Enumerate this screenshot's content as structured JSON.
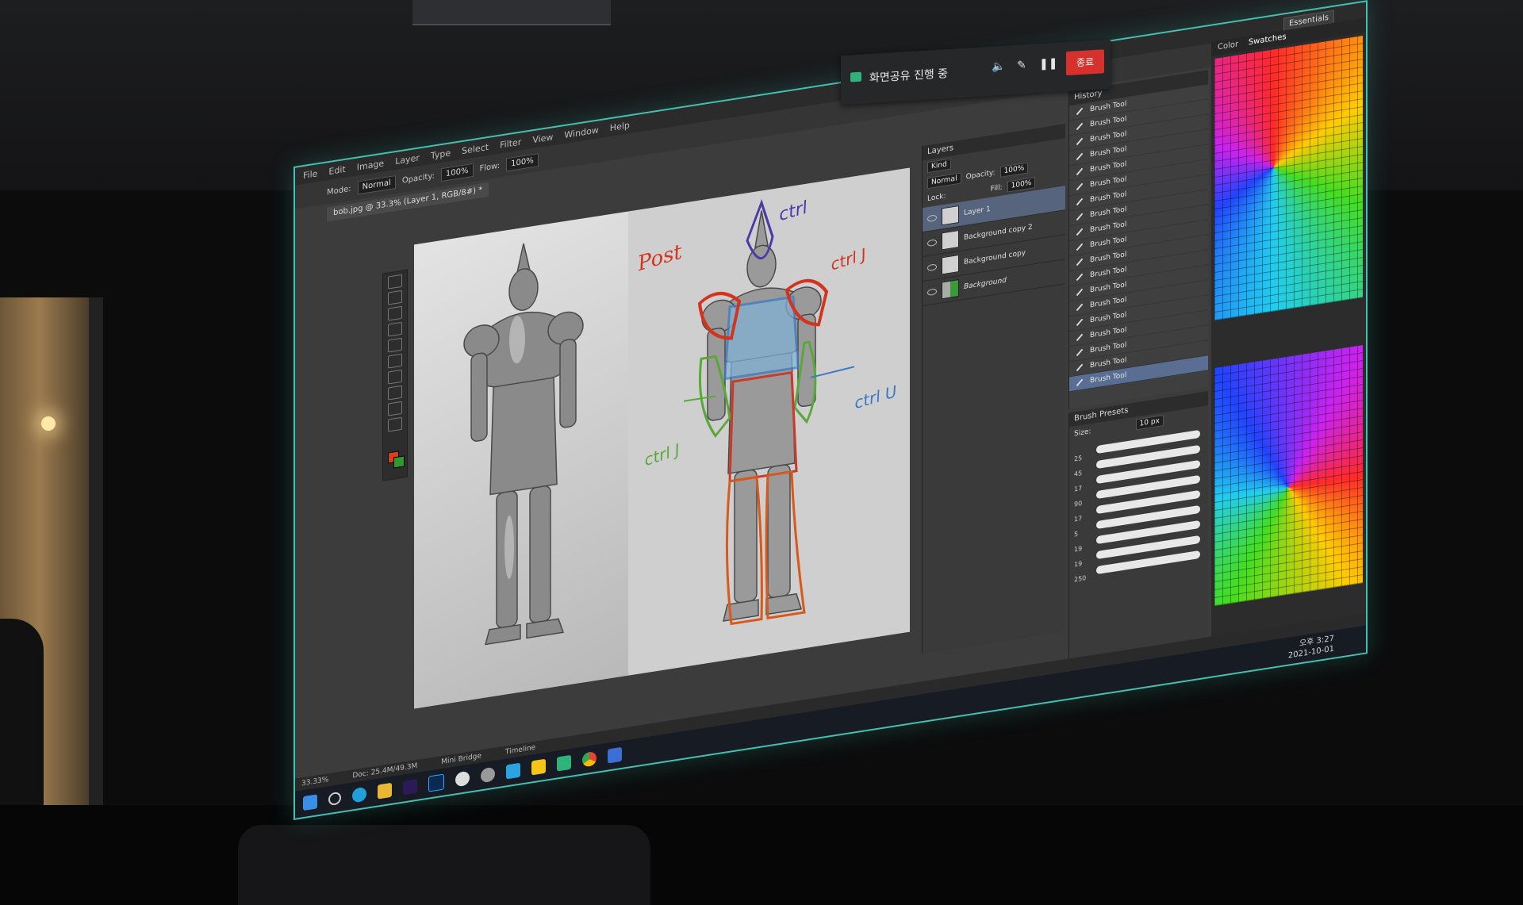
{
  "screen_share": {
    "label": "화면공유 진행 중",
    "end_label": "종료"
  },
  "photoshop": {
    "menu": [
      "File",
      "Edit",
      "Image",
      "Layer",
      "Type",
      "Select",
      "Filter",
      "View",
      "Window",
      "Help"
    ],
    "options": {
      "mode_label": "Mode:",
      "mode_value": "Normal",
      "opacity_label": "Opacity:",
      "opacity_value": "100%",
      "flow_label": "Flow:",
      "flow_value": "100%"
    },
    "doc_tab": "bob.jpg @ 33.3% (Layer 1, RGB/8#) *",
    "workspace": "Essentials",
    "layers_panel": {
      "title": "Layers",
      "kind": "Kind",
      "blend": "Normal",
      "opacity_label": "Opacity:",
      "opacity_value": "100%",
      "lock_label": "Lock:",
      "fill_label": "Fill:",
      "fill_value": "100%",
      "layers": [
        "Layer 1",
        "Background copy 2",
        "Background copy",
        "Background"
      ]
    },
    "history_panel": {
      "title": "History",
      "items": [
        "Brush Tool",
        "Brush Tool",
        "Brush Tool",
        "Brush Tool",
        "Brush Tool",
        "Brush Tool",
        "Brush Tool",
        "Brush Tool",
        "Brush Tool",
        "Brush Tool",
        "Brush Tool",
        "Brush Tool",
        "Brush Tool",
        "Brush Tool",
        "Brush Tool",
        "Brush Tool",
        "Brush Tool",
        "Brush Tool",
        "Brush Tool"
      ]
    },
    "brush_presets": {
      "title": "Brush Presets",
      "size_label": "Size:",
      "size_value": "10 px",
      "sizes": [
        "25",
        "45",
        "17",
        "90",
        "17",
        "5",
        "19",
        "19",
        "250"
      ]
    },
    "color_panel": {
      "tabs": [
        "Color",
        "Swatches"
      ]
    },
    "annotations": [
      "Post",
      "ctrl",
      "ctrl J",
      "ctrl J",
      "ctrl U"
    ],
    "status": {
      "zoom": "33.33%",
      "doc": "Doc: 25.4M/49.3M"
    },
    "bottom_tabs": [
      "Mini Bridge",
      "Timeline"
    ]
  },
  "taskbar": {
    "time": "오후 3:27",
    "date": "2021-10-01"
  }
}
